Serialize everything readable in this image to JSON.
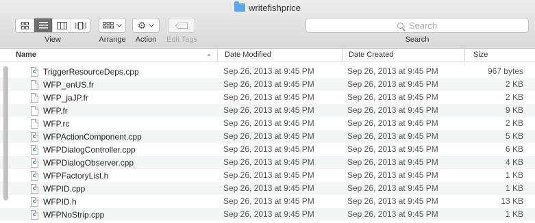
{
  "window": {
    "title": "writefishprice"
  },
  "toolbar": {
    "view_label": "View",
    "arrange_label": "Arrange",
    "action_label": "Action",
    "edit_tags_label": "Edit Tags",
    "search_placeholder": "Search",
    "search_label": "Search",
    "view_modes": [
      "icon",
      "list",
      "column",
      "cover-flow"
    ],
    "selected_view": "list"
  },
  "columns": {
    "name": "Name",
    "modified": "Date Modified",
    "created": "Date Created",
    "size": "Size"
  },
  "files": [
    {
      "name": "TriggerResourceDeps.cpp",
      "icon": "cpp-file-icon",
      "modified": "Sep 26, 2013 at 9:45 PM",
      "created": "Sep 26, 2013 at 9:45 PM",
      "size": "967 bytes"
    },
    {
      "name": "WFP_enUS.fr",
      "icon": "text-file-icon",
      "modified": "Sep 26, 2013 at 9:45 PM",
      "created": "Sep 26, 2013 at 9:45 PM",
      "size": "2 KB"
    },
    {
      "name": "WFP_jaJP.fr",
      "icon": "text-file-icon",
      "modified": "Sep 26, 2013 at 9:45 PM",
      "created": "Sep 26, 2013 at 9:45 PM",
      "size": "2 KB"
    },
    {
      "name": "WFP.fr",
      "icon": "text-file-icon",
      "modified": "Sep 26, 2013 at 9:45 PM",
      "created": "Sep 26, 2013 at 9:45 PM",
      "size": "9 KB"
    },
    {
      "name": "WFP.rc",
      "icon": "text-file-icon",
      "modified": "Sep 26, 2013 at 9:45 PM",
      "created": "Sep 26, 2013 at 9:45 PM",
      "size": "2 KB"
    },
    {
      "name": "WFPActionComponent.cpp",
      "icon": "cpp-file-icon",
      "modified": "Sep 26, 2013 at 9:45 PM",
      "created": "Sep 26, 2013 at 9:45 PM",
      "size": "5 KB"
    },
    {
      "name": "WFPDialogController.cpp",
      "icon": "cpp-file-icon",
      "modified": "Sep 26, 2013 at 9:45 PM",
      "created": "Sep 26, 2013 at 9:45 PM",
      "size": "6 KB"
    },
    {
      "name": "WFPDialogObserver.cpp",
      "icon": "cpp-file-icon",
      "modified": "Sep 26, 2013 at 9:45 PM",
      "created": "Sep 26, 2013 at 9:45 PM",
      "size": "4 KB"
    },
    {
      "name": "WFPFactoryList.h",
      "icon": "header-file-icon",
      "modified": "Sep 26, 2013 at 9:45 PM",
      "created": "Sep 26, 2013 at 9:45 PM",
      "size": "1 KB"
    },
    {
      "name": "WFPID.cpp",
      "icon": "cpp-file-icon",
      "modified": "Sep 26, 2013 at 9:45 PM",
      "created": "Sep 26, 2013 at 9:45 PM",
      "size": "1 KB"
    },
    {
      "name": "WFPID.h",
      "icon": "header-file-icon",
      "modified": "Sep 26, 2013 at 9:45 PM",
      "created": "Sep 26, 2013 at 9:45 PM",
      "size": "13 KB"
    },
    {
      "name": "WFPNoStrip.cpp",
      "icon": "cpp-file-icon",
      "modified": "Sep 26, 2013 at 9:45 PM",
      "created": "Sep 26, 2013 at 9:45 PM",
      "size": "1 KB"
    }
  ]
}
